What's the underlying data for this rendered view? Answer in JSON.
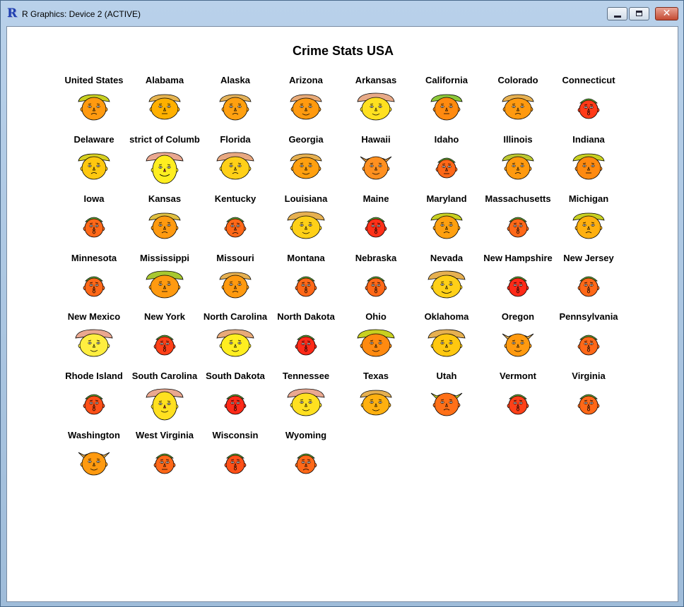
{
  "window": {
    "title": "R Graphics: Device 2 (ACTIVE)",
    "app_icon": "R"
  },
  "controls": {
    "minimize": "minimize-icon",
    "maximize": "maximize-icon",
    "close": "✕"
  },
  "plot": {
    "title": "Crime Stats USA"
  },
  "faces": [
    {
      "label": "United States",
      "hair": "#c8d020",
      "skin": "#ff9a10",
      "style": "cap",
      "mouth": "frown"
    },
    {
      "label": "Alabama",
      "hair": "#e6b450",
      "skin": "#ffb000",
      "style": "wide",
      "mouth": "line"
    },
    {
      "label": "Alaska",
      "hair": "#e3b15a",
      "skin": "#ffa010",
      "style": "cap",
      "mouth": "frown"
    },
    {
      "label": "Arizona",
      "hair": "#e8aa78",
      "skin": "#ff9a10",
      "style": "wide",
      "mouth": "smile"
    },
    {
      "label": "Arkansas",
      "hair": "#e8aa88",
      "skin": "#ffe020",
      "style": "hat",
      "mouth": "smile"
    },
    {
      "label": "California",
      "hair": "#8cc83a",
      "skin": "#ff8a10",
      "style": "cap",
      "mouth": "line"
    },
    {
      "label": "Colorado",
      "hair": "#e6b050",
      "skin": "#ff9a10",
      "style": "wide",
      "mouth": "frown"
    },
    {
      "label": "Connecticut",
      "hair": "#6cbe3a",
      "skin": "#ff3a18",
      "style": "small",
      "mouth": "o"
    },
    {
      "label": "Delaware",
      "hair": "#d8d020",
      "skin": "#ffc810",
      "style": "cap",
      "mouth": "frown"
    },
    {
      "label": "strict of Columb",
      "hair": "#eaa890",
      "skin": "#ffee20",
      "style": "tall",
      "mouth": "big"
    },
    {
      "label": "Florida",
      "hair": "#e8a880",
      "skin": "#ffd018",
      "style": "hat",
      "mouth": "frown"
    },
    {
      "label": "Georgia",
      "hair": "#e6b050",
      "skin": "#ffa010",
      "style": "wide",
      "mouth": "smile"
    },
    {
      "label": "Hawaii",
      "hair": "#e39a40",
      "skin": "#ff9020",
      "style": "horn",
      "mouth": "smile"
    },
    {
      "label": "Idaho",
      "hair": "#6cbe3a",
      "skin": "#ff6818",
      "style": "small",
      "mouth": "line"
    },
    {
      "label": "Illinois",
      "hair": "#bcc830",
      "skin": "#ff9a10",
      "style": "cap",
      "mouth": "frown"
    },
    {
      "label": "Indiana",
      "hair": "#c8d020",
      "skin": "#ff8a10",
      "style": "cap",
      "mouth": "line"
    },
    {
      "label": "Iowa",
      "hair": "#6cbe3a",
      "skin": "#ff6818",
      "style": "small",
      "mouth": "o"
    },
    {
      "label": "Kansas",
      "hair": "#e0c040",
      "skin": "#ff9a10",
      "style": "cap",
      "mouth": "frown"
    },
    {
      "label": "Kentucky",
      "hair": "#6cbe3a",
      "skin": "#ff6818",
      "style": "small",
      "mouth": "frown"
    },
    {
      "label": "Louisiana",
      "hair": "#e6b050",
      "skin": "#ffd018",
      "style": "hat",
      "mouth": "smile"
    },
    {
      "label": "Maine",
      "hair": "#6cbe3a",
      "skin": "#ff3018",
      "style": "small",
      "mouth": "o"
    },
    {
      "label": "Maryland",
      "hair": "#c8d020",
      "skin": "#ffa010",
      "style": "cap",
      "mouth": "frown"
    },
    {
      "label": "Massachusetts",
      "hair": "#6cbe3a",
      "skin": "#ff6818",
      "style": "small",
      "mouth": "o"
    },
    {
      "label": "Michigan",
      "hair": "#c8d020",
      "skin": "#ffb010",
      "style": "cap",
      "mouth": "frown"
    },
    {
      "label": "Minnesota",
      "hair": "#6cbe3a",
      "skin": "#ff6818",
      "style": "small",
      "mouth": "o"
    },
    {
      "label": "Mississippi",
      "hair": "#a8c830",
      "skin": "#ff9a10",
      "style": "hat",
      "mouth": "line"
    },
    {
      "label": "Missouri",
      "hair": "#e6b050",
      "skin": "#ff9a10",
      "style": "cap",
      "mouth": "frown"
    },
    {
      "label": "Montana",
      "hair": "#6cbe3a",
      "skin": "#ff6818",
      "style": "small",
      "mouth": "o"
    },
    {
      "label": "Nebraska",
      "hair": "#6cbe3a",
      "skin": "#ff6818",
      "style": "small",
      "mouth": "o"
    },
    {
      "label": "Nevada",
      "hair": "#e6b050",
      "skin": "#ffd018",
      "style": "hat",
      "mouth": "big"
    },
    {
      "label": "New Hampshire",
      "hair": "#6cbe3a",
      "skin": "#ff2a18",
      "style": "small",
      "mouth": "o"
    },
    {
      "label": "New Jersey",
      "hair": "#6cbe3a",
      "skin": "#ff6818",
      "style": "small",
      "mouth": "o"
    },
    {
      "label": "New Mexico",
      "hair": "#eaa890",
      "skin": "#ffee40",
      "style": "hat",
      "mouth": "smile"
    },
    {
      "label": "New York",
      "hair": "#6cbe3a",
      "skin": "#ff4018",
      "style": "small",
      "mouth": "o"
    },
    {
      "label": "North Carolina",
      "hair": "#e8aa78",
      "skin": "#ffee20",
      "style": "hat",
      "mouth": "smile"
    },
    {
      "label": "North Dakota",
      "hair": "#6cbe3a",
      "skin": "#ff2a18",
      "style": "small",
      "mouth": "o"
    },
    {
      "label": "Ohio",
      "hair": "#c8d020",
      "skin": "#ff8a10",
      "style": "hat",
      "mouth": "smile"
    },
    {
      "label": "Oklahoma",
      "hair": "#e6b050",
      "skin": "#ffc810",
      "style": "hat",
      "mouth": "smile"
    },
    {
      "label": "Oregon",
      "hair": "#e6b050",
      "skin": "#ff9a10",
      "style": "horn",
      "mouth": "smile"
    },
    {
      "label": "Pennsylvania",
      "hair": "#6cbe3a",
      "skin": "#ff6818",
      "style": "small",
      "mouth": "o"
    },
    {
      "label": "Rhode Island",
      "hair": "#6cbe3a",
      "skin": "#ff5018",
      "style": "small",
      "mouth": "o"
    },
    {
      "label": "South Carolina",
      "hair": "#eaa890",
      "skin": "#ffe020",
      "style": "tall",
      "mouth": "smile"
    },
    {
      "label": "South Dakota",
      "hair": "#6cbe3a",
      "skin": "#ff2a18",
      "style": "small",
      "mouth": "o"
    },
    {
      "label": "Tennessee",
      "hair": "#eaa890",
      "skin": "#ffe020",
      "style": "hat",
      "mouth": "smile"
    },
    {
      "label": "Texas",
      "hair": "#e6b050",
      "skin": "#ffb010",
      "style": "wide",
      "mouth": "smile"
    },
    {
      "label": "Utah",
      "hair": "#c8d020",
      "skin": "#ff7018",
      "style": "horn",
      "mouth": "frown"
    },
    {
      "label": "Vermont",
      "hair": "#6cbe3a",
      "skin": "#ff4018",
      "style": "small",
      "mouth": "o"
    },
    {
      "label": "Virginia",
      "hair": "#6cbe3a",
      "skin": "#ff6818",
      "style": "small",
      "mouth": "o"
    },
    {
      "label": "Washington",
      "hair": "#e6b050",
      "skin": "#ff9a10",
      "style": "horn",
      "mouth": "smile"
    },
    {
      "label": "West Virginia",
      "hair": "#6cbe3a",
      "skin": "#ff6818",
      "style": "small",
      "mouth": "line"
    },
    {
      "label": "Wisconsin",
      "hair": "#6cbe3a",
      "skin": "#ff5018",
      "style": "small",
      "mouth": "o"
    },
    {
      "label": "Wyoming",
      "hair": "#6cbe3a",
      "skin": "#ff6818",
      "style": "small",
      "mouth": "frown"
    }
  ]
}
